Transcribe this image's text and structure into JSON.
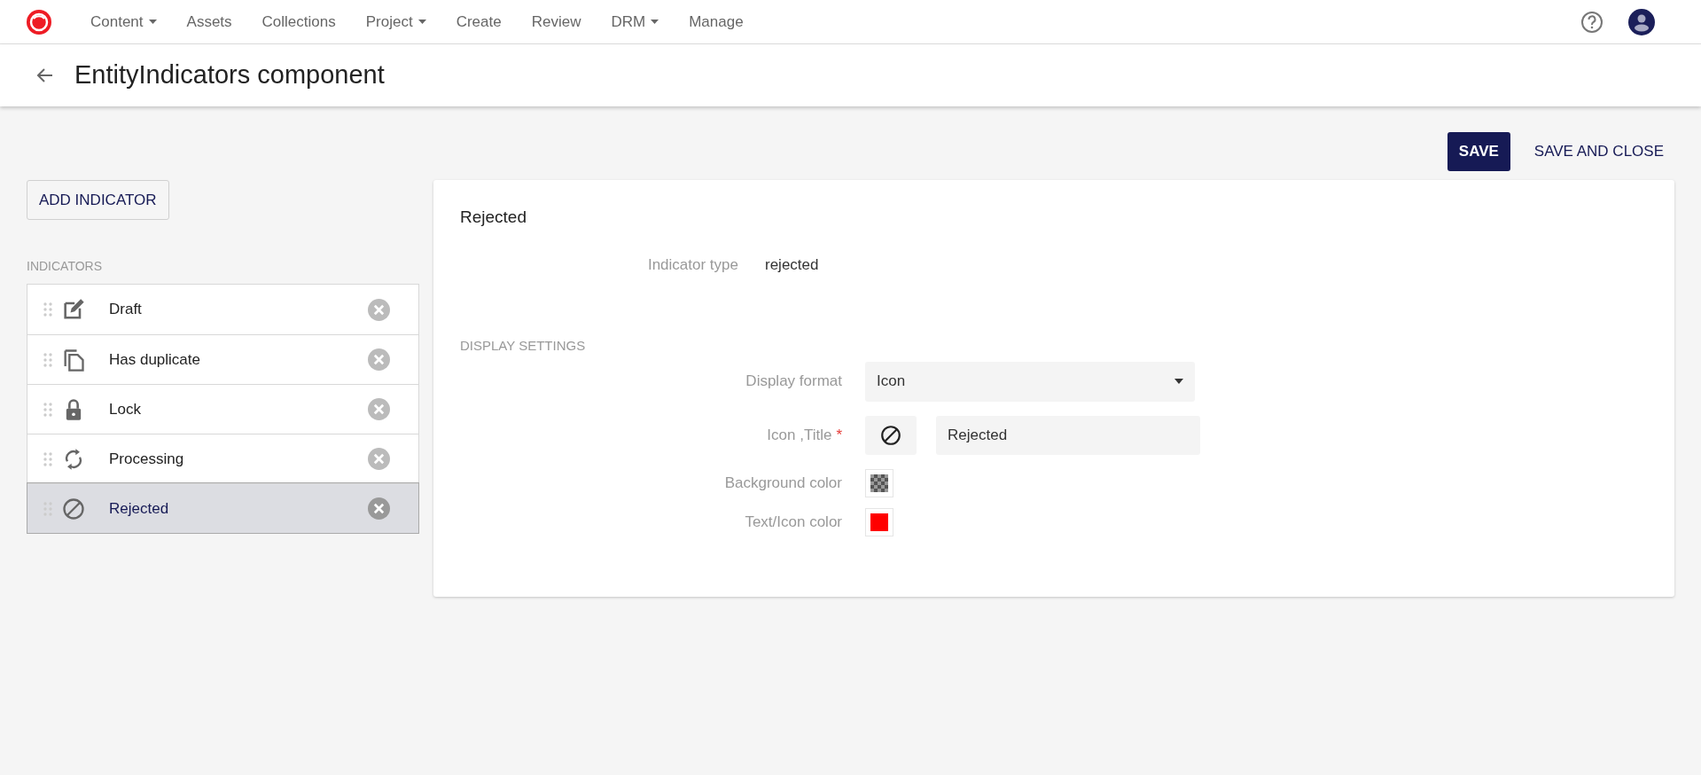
{
  "nav": {
    "items": [
      {
        "label": "Content",
        "dropdown": true
      },
      {
        "label": "Assets",
        "dropdown": false
      },
      {
        "label": "Collections",
        "dropdown": false
      },
      {
        "label": "Project",
        "dropdown": true
      },
      {
        "label": "Create",
        "dropdown": false
      },
      {
        "label": "Review",
        "dropdown": false
      },
      {
        "label": "DRM",
        "dropdown": true
      },
      {
        "label": "Manage",
        "dropdown": false
      }
    ]
  },
  "header": {
    "title": "EntityIndicators component"
  },
  "actions": {
    "save": "SAVE",
    "save_and_close": "SAVE AND CLOSE"
  },
  "sidebar": {
    "add_button": "ADD INDICATOR",
    "section_label": "INDICATORS",
    "items": [
      {
        "label": "Draft",
        "kind": "edit",
        "selected": false
      },
      {
        "label": "Has duplicate",
        "kind": "copy",
        "selected": false
      },
      {
        "label": "Lock",
        "kind": "lock",
        "selected": false
      },
      {
        "label": "Processing",
        "kind": "sync",
        "selected": false
      },
      {
        "label": "Rejected",
        "kind": "block",
        "selected": true
      }
    ]
  },
  "detail": {
    "title": "Rejected",
    "indicator_type": {
      "label": "Indicator type",
      "value": "rejected"
    },
    "section_label": "DISPLAY SETTINGS",
    "display_format": {
      "label": "Display format",
      "value": "Icon"
    },
    "icon_title": {
      "label": "Icon ,Title",
      "required_mark": "*",
      "kind": "block",
      "value": "Rejected"
    },
    "colors": [
      {
        "label": "Background color",
        "kind": "transparent"
      },
      {
        "label": "Text/Icon color",
        "kind": "solid",
        "color": "#ff0000"
      }
    ]
  }
}
